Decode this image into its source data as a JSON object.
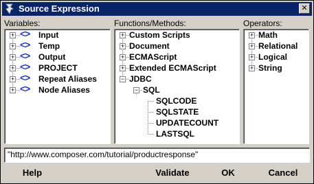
{
  "window": {
    "title": "Source Expression",
    "close_glyph": "✕"
  },
  "variables": {
    "label": "Variables:",
    "items": [
      {
        "label": "Input",
        "expander": "+",
        "icon": "<>"
      },
      {
        "label": "Temp",
        "expander": "+",
        "icon": "<>"
      },
      {
        "label": "Output",
        "expander": "+",
        "icon": "<>"
      },
      {
        "label": "PROJECT",
        "expander": "+",
        "icon": "<>"
      },
      {
        "label": "Repeat Aliases",
        "expander": "+",
        "icon": "<>"
      },
      {
        "label": "Node Aliases",
        "expander": "+",
        "icon": "<>"
      }
    ]
  },
  "functions": {
    "label": "Functions/Methods:",
    "items": [
      {
        "label": "Custom Scripts",
        "expander": "+"
      },
      {
        "label": "Document",
        "expander": "+"
      },
      {
        "label": "ECMAScript",
        "expander": "+"
      },
      {
        "label": "Extended ECMAScript",
        "expander": "+"
      },
      {
        "label": "JDBC",
        "expander": "−"
      },
      {
        "label": "SQL",
        "expander": "−"
      },
      {
        "label": "SQLCODE"
      },
      {
        "label": "SQLSTATE"
      },
      {
        "label": "UPDATECOUNT"
      },
      {
        "label": "LASTSQL"
      }
    ]
  },
  "operators": {
    "label": "Operators:",
    "items": [
      {
        "label": "Math",
        "expander": "+"
      },
      {
        "label": "Relational",
        "expander": "+"
      },
      {
        "label": "Logical",
        "expander": "+"
      },
      {
        "label": "String",
        "expander": "+"
      }
    ]
  },
  "expression": {
    "value": "\"http://www.composer.com/tutorial/productresponse\""
  },
  "buttons": {
    "help": "Help",
    "validate": "Validate",
    "ok": "OK",
    "cancel": "Cancel"
  },
  "colors": {
    "titlebar": "#0a246a",
    "variable_icon": "#1c3ea8",
    "face": "#d4d0c8"
  }
}
